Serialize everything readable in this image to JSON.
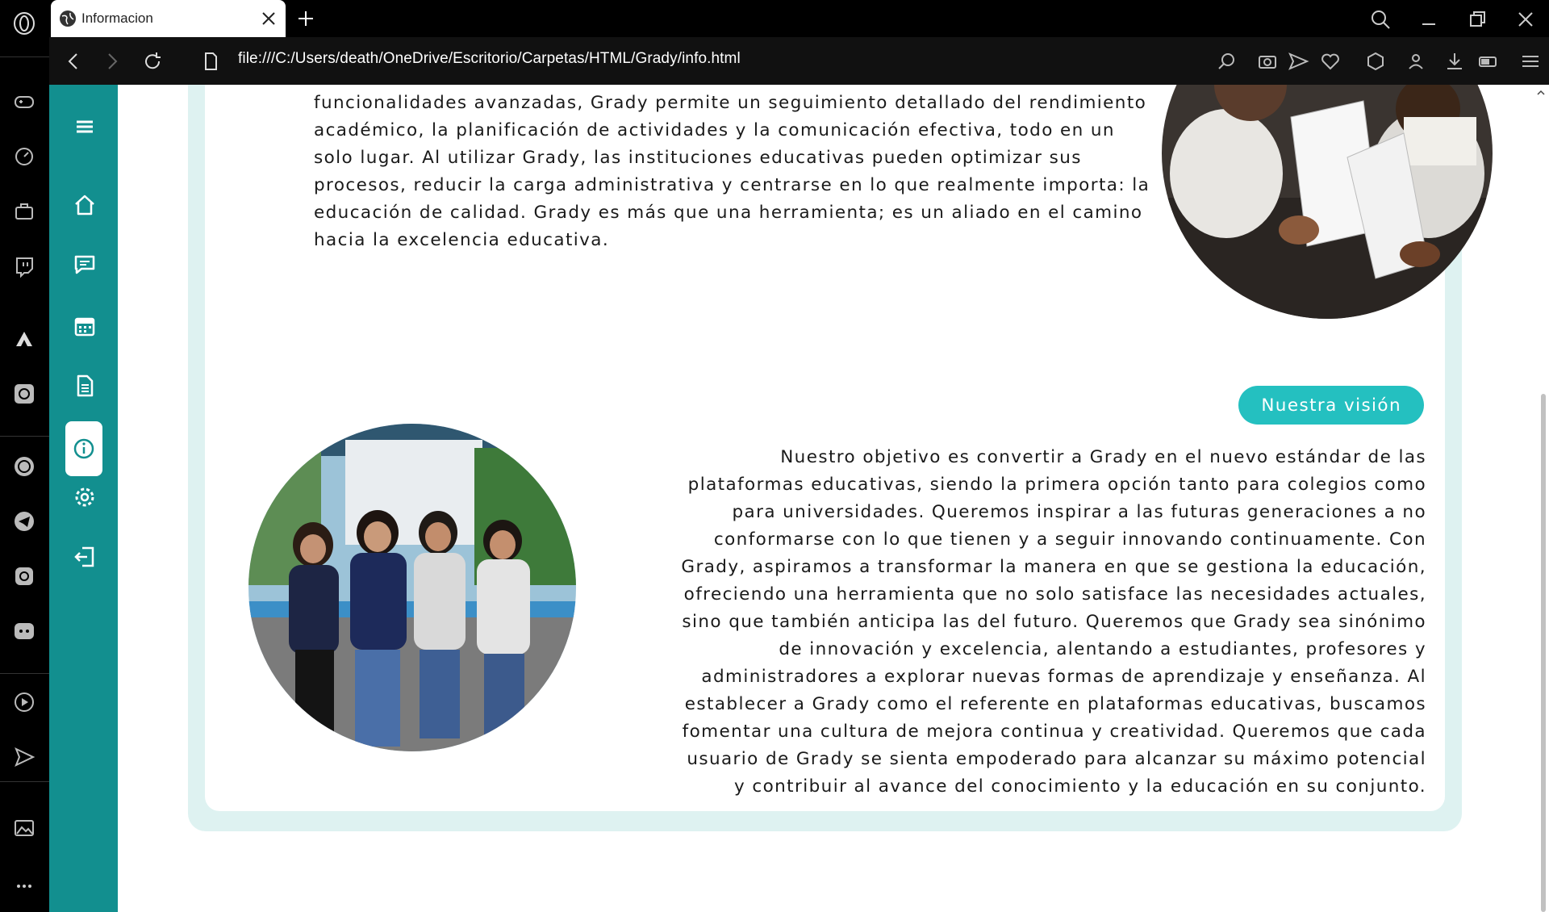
{
  "browser": {
    "tab_title": "Informacion",
    "url": "file:///C:/Users/death/OneDrive/Escritorio/Carpetas/HTML/Grady/info.html",
    "opera_sidebar_icons": [
      "opera-logo-icon",
      "gamepad-icon",
      "speed-dial-icon",
      "briefcase-icon",
      "twitch-icon",
      "aria-icon",
      "chatgpt-icon",
      "whatsapp-icon",
      "telegram-icon",
      "instagram-icon",
      "discord-icon",
      "player-icon",
      "send-icon",
      "image-icon",
      "more-icon"
    ]
  },
  "app": {
    "sidebar_icons": [
      "menu-icon",
      "home-icon",
      "chat-icon",
      "calendar-icon",
      "document-icon",
      "info-icon",
      "settings-icon",
      "logout-icon"
    ],
    "accent_color": "#128f8f",
    "badge_color": "#24c0c0"
  },
  "card1": {
    "text": "académica, sino que también promueve una mayor interacción y colaboración entre todos los miembros de la comunidad educativa. Con su interfaz amigable y funcionalidades avanzadas, Grady permite un seguimiento detallado del rendimiento académico, la planificación de actividades y la comunicación efectiva, todo en un solo lugar. Al utilizar Grady, las instituciones educativas pueden optimizar sus procesos, reducir la carga administrativa y centrarse en lo que realmente importa: la educación de calidad. Grady es más que una herramienta; es un aliado en el camino hacia la excelencia educativa."
  },
  "card2": {
    "badge": "Nuestra visión",
    "text": "Nuestro objetivo es convertir a Grady en el nuevo estándar de las plataformas educativas, siendo la primera opción tanto para colegios como para universidades. Queremos inspirar a las futuras generaciones a no conformarse con lo que tienen y a seguir innovando continuamente. Con Grady, aspiramos a transformar la manera en que se gestiona la educación, ofreciendo una herramienta que no solo satisface las necesidades actuales, sino que también anticipa las del futuro. Queremos que Grady sea sinónimo de innovación y excelencia, alentando a estudiantes, profesores y administradores a explorar nuevas formas de aprendizaje y enseñanza. Al establecer a Grady como el referente en plataformas educativas, buscamos fomentar una cultura de mejora continua y creatividad. Queremos que cada usuario de Grady se sienta empoderado para alcanzar su máximo potencial y contribuir al avance del conocimiento y la educación en su conjunto."
  }
}
